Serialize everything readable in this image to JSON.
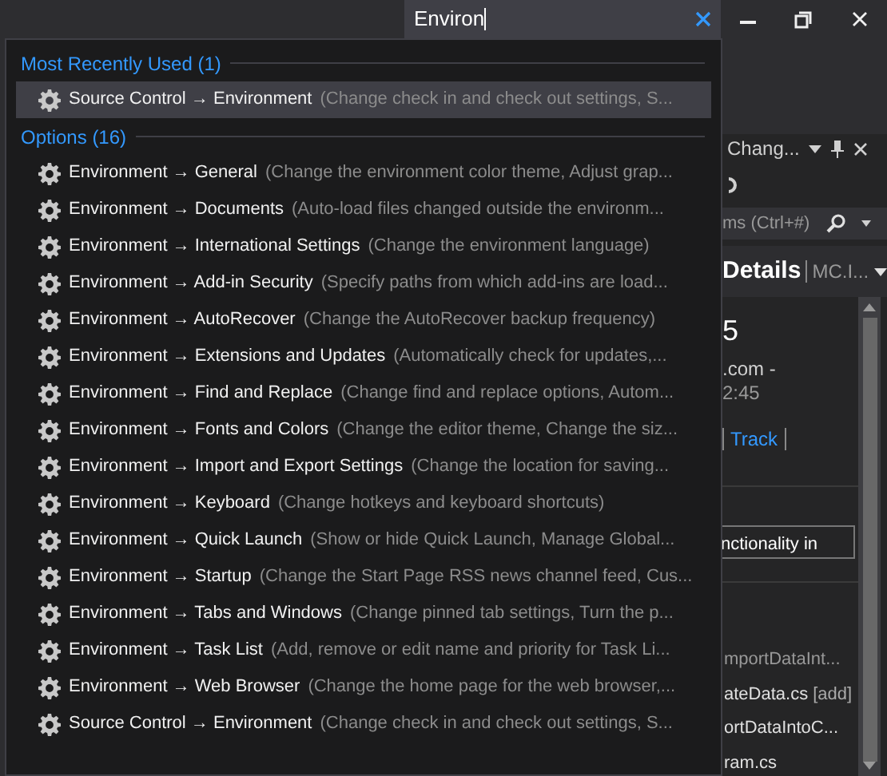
{
  "search": {
    "value": "Environ"
  },
  "groups": [
    {
      "title": "Most Recently Used (1)",
      "items": [
        {
          "path": "Source Control → Environment",
          "description": "(Change check in and check out settings, S...",
          "selected": true
        }
      ]
    },
    {
      "title": "Options (16)",
      "items": [
        {
          "path": "Environment → General",
          "description": "(Change the environment color theme, Adjust grap...",
          "selected": false
        },
        {
          "path": "Environment → Documents",
          "description": "(Auto-load files changed outside the environm...",
          "selected": false
        },
        {
          "path": "Environment → International Settings",
          "description": "(Change the environment language)",
          "selected": false
        },
        {
          "path": "Environment → Add-in Security",
          "description": "(Specify paths from which add-ins are load...",
          "selected": false
        },
        {
          "path": "Environment → AutoRecover",
          "description": "(Change the AutoRecover backup frequency)",
          "selected": false
        },
        {
          "path": "Environment → Extensions and Updates",
          "description": "(Automatically check for updates,...",
          "selected": false
        },
        {
          "path": "Environment → Find and Replace",
          "description": "(Change find and replace options, Autom...",
          "selected": false
        },
        {
          "path": "Environment → Fonts and Colors",
          "description": "(Change the editor theme, Change the siz...",
          "selected": false
        },
        {
          "path": "Environment → Import and Export Settings",
          "description": "(Change the location for saving...",
          "selected": false
        },
        {
          "path": "Environment → Keyboard",
          "description": "(Change hotkeys and keyboard shortcuts)",
          "selected": false
        },
        {
          "path": "Environment → Quick Launch",
          "description": "(Show or hide Quick Launch, Manage Global...",
          "selected": false
        },
        {
          "path": "Environment → Startup",
          "description": "(Change the Start Page RSS news channel feed, Cus...",
          "selected": false
        },
        {
          "path": "Environment → Tabs and Windows",
          "description": "(Change pinned tab settings, Turn the p...",
          "selected": false
        },
        {
          "path": "Environment → Task List",
          "description": "(Add, remove or edit name and priority for Task Li...",
          "selected": false
        },
        {
          "path": "Environment → Web Browser",
          "description": "(Change the home page for the web browser,...",
          "selected": false
        },
        {
          "path": "Source Control → Environment",
          "description": "(Change check in and check out settings, S...",
          "selected": false
        }
      ]
    }
  ],
  "panel": {
    "title": "Chang...",
    "search_placeholder": "ms (Ctrl+#)",
    "heading": "Details",
    "context": "MC.I...",
    "changeset_number": "5",
    "owner": ".com -",
    "time": "2:45",
    "link": "Track",
    "comment": "nctionality in",
    "files": [
      {
        "name": "mportDataInt..."
      },
      {
        "name": "ateData.cs",
        "change": "[add]"
      },
      {
        "name": "ortDataIntoC..."
      },
      {
        "name": "ram.cs"
      }
    ]
  }
}
